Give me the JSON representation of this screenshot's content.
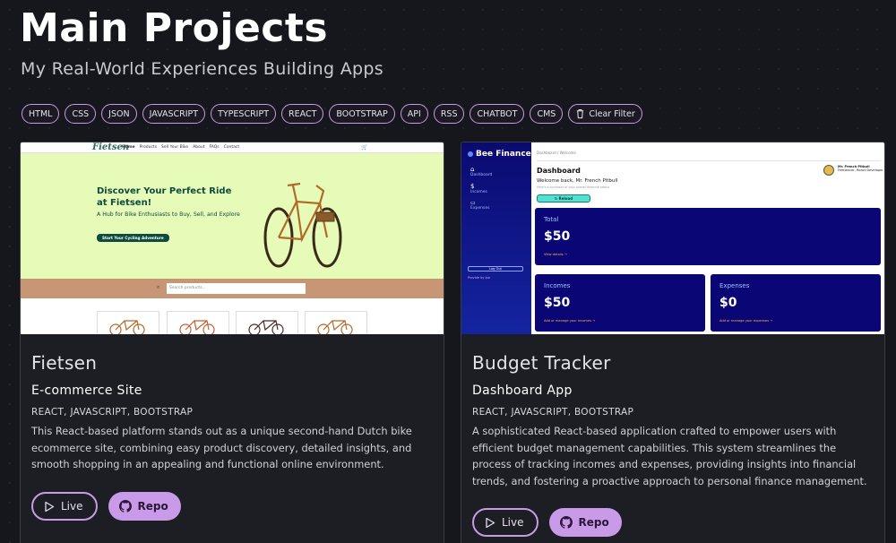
{
  "header": {
    "title": "Main Projects",
    "subtitle": "My Real-World Experiences Building Apps"
  },
  "filters": {
    "tags": [
      "HTML",
      "CSS",
      "JSON",
      "JAVASCRIPT",
      "TYPESCRIPT",
      "REACT",
      "BOOTSTRAP",
      "API",
      "RSS",
      "CHATBOT",
      "CMS"
    ],
    "clear_label": "Clear Filter"
  },
  "colors": {
    "accent": "#c99ae8",
    "background": "#15171c",
    "card": "#1c1e23"
  },
  "projects": [
    {
      "title": "Fietsen",
      "subtitle": "E-commerce Site",
      "tech": "REACT, JAVASCRIPT, BOOTSTRAP",
      "description": "This React-based platform stands out as a unique second-hand Dutch bike ecommerce site, combining easy product discovery, detailed insights, and smooth shopping in an appealing and functional online environment.",
      "live_label": "Live",
      "repo_label": "Repo",
      "preview": {
        "logo": "Fietsen",
        "nav": [
          "Home",
          "Products",
          "Sell Your Bike",
          "About",
          "FAQs",
          "Contact"
        ],
        "hero_title": "Discover Your Perfect Ride at Fietsen!",
        "hero_subtitle": "A Hub for Bike Enthusiasts to Buy, Sell, and Explore",
        "cta": "Start Your Cycling Adventure",
        "search_placeholder": "Search products..."
      }
    },
    {
      "title": "Budget Tracker",
      "subtitle": "Dashboard App",
      "tech": "REACT, JAVASCRIPT, BOOTSTRAP",
      "description": "A sophisticated React-based application crafted to empower users with efficient budget management capabilities. This system streamlines the process of tracking incomes and expenses, providing insights into financial trends, and fostering a proactive approach to personal finance management.",
      "live_label": "Live",
      "repo_label": "Repo",
      "preview": {
        "brand": "Bee Finance",
        "nav": [
          "Dashboard",
          "Incomes",
          "Expenses"
        ],
        "logout": "Log Out",
        "provided_by": "Provide by Ipo",
        "crumb": "Dashboard / Welcome",
        "title": "Dashboard",
        "welcome": "Welcome back, Mr. French Pitbull",
        "summary": "Here's a summary of your overall financial status",
        "reload": "Reload",
        "user_name": "Mr. French Pitbull",
        "user_role": "Freelancer, React Developer",
        "total_label": "Total",
        "total_amount": "$50",
        "total_link": "View details →",
        "incomes_label": "Incomes",
        "incomes_amount": "$50",
        "incomes_link": "Add or manage your incomes →",
        "expenses_label": "Expenses",
        "expenses_amount": "$0",
        "expenses_link": "Add or manage your expenses →"
      }
    }
  ]
}
